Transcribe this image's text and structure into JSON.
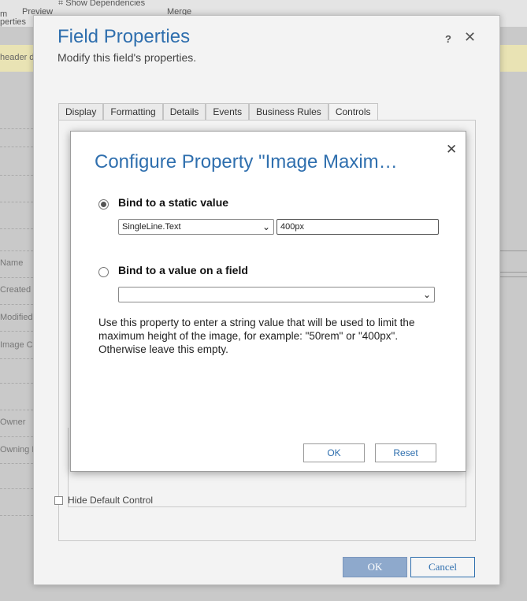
{
  "background": {
    "toolbar_items": [
      "Preview",
      "Show Dependencies",
      "Merge",
      "m",
      "perties"
    ],
    "banner_text": "header d",
    "form_labels": [
      "Name",
      "Created",
      "Modified",
      "Image C",
      "Owner",
      "Owning B"
    ]
  },
  "field_properties": {
    "title": "Field Properties",
    "subtitle": "Modify this field's properties.",
    "help_label": "?",
    "close_label": "✕",
    "tabs": [
      {
        "label": "Display"
      },
      {
        "label": "Formatting"
      },
      {
        "label": "Details"
      },
      {
        "label": "Events"
      },
      {
        "label": "Business Rules"
      },
      {
        "label": "Controls",
        "active": true
      }
    ],
    "hide_default_control_label": "Hide Default Control",
    "ok_label": "OK",
    "cancel_label": "Cancel"
  },
  "configure_property": {
    "title": "Configure Property \"Image Maxim…",
    "close_label": "✕",
    "static_option_label": "Bind to a static value",
    "static_type_selected": "SingleLine.Text",
    "static_value": "400px",
    "field_option_label": "Bind to a value on a field",
    "field_selected": "",
    "description": "Use this property to enter a string value that will be used to limit the maximum height of the image, for example: \"50rem\" or \"400px\". Otherwise leave this empty.",
    "ok_label": "OK",
    "reset_label": "Reset"
  },
  "colors": {
    "title_blue": "#2f6fae",
    "primary_button": "#8ea9cc",
    "banner_yellow": "#e9e3b4"
  }
}
